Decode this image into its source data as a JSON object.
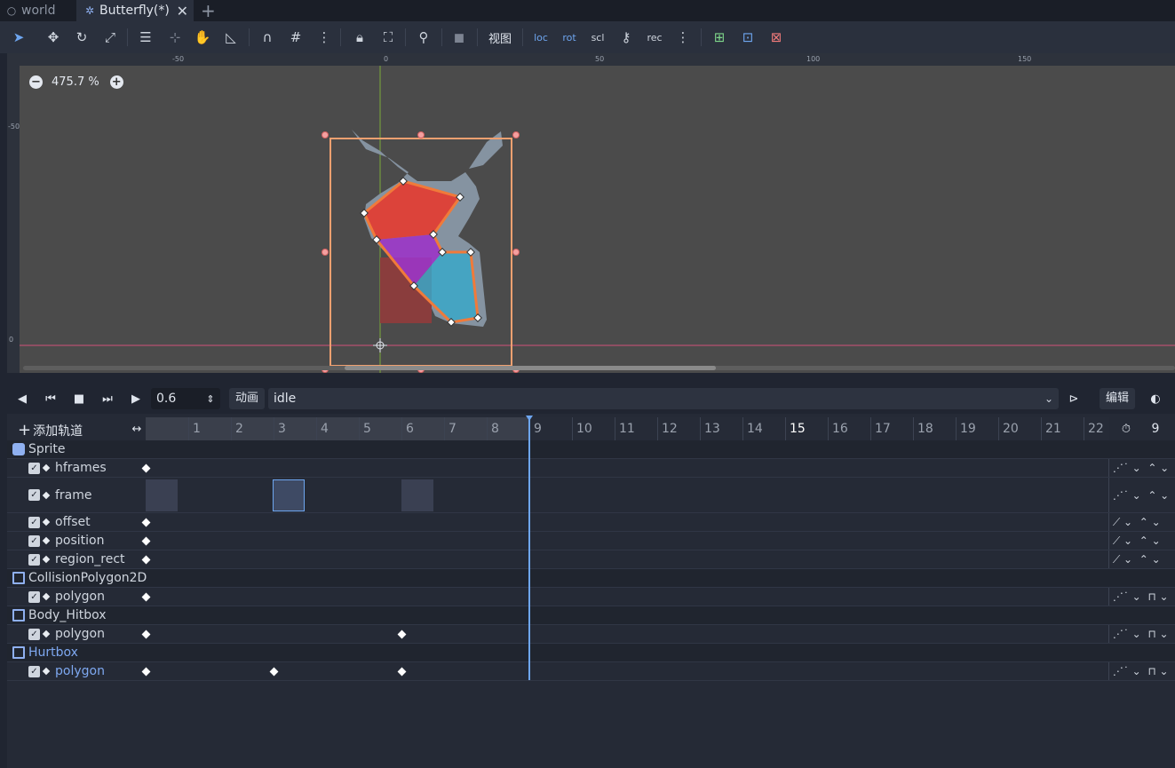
{
  "tabs": [
    {
      "label": "world",
      "icon": "circle-icon"
    },
    {
      "label": "Butterfly(*)",
      "icon": "node-icon"
    }
  ],
  "toolbar": {
    "view_label": "视图"
  },
  "viewport": {
    "zoom": "475.7 %",
    "ruler_top": [
      "-50",
      "0",
      "50",
      "100",
      "150"
    ],
    "ruler_left": [
      "-50",
      "0"
    ]
  },
  "animation": {
    "time": "0.6",
    "anim_label": "动画",
    "current_animation": "idle",
    "edit_label": "编辑",
    "add_track_label": "添加轨道",
    "timeline_ticks": [
      "1",
      "2",
      "3",
      "4",
      "5",
      "6",
      "7",
      "8",
      "9",
      "10",
      "11",
      "12",
      "13",
      "14",
      "15",
      "16",
      "17",
      "18",
      "19",
      "20",
      "21",
      "22"
    ],
    "last_column_label": "9",
    "groups": [
      {
        "name": "Sprite",
        "tracks": [
          "hframes",
          "frame",
          "offset",
          "position",
          "region_rect"
        ]
      },
      {
        "name": "CollisionPolygon2D",
        "tracks": [
          "polygon"
        ]
      },
      {
        "name": "Body_Hitbox",
        "tracks": [
          "polygon"
        ]
      },
      {
        "name": "Hurtbox",
        "tracks": [
          "polygon"
        ]
      }
    ]
  }
}
